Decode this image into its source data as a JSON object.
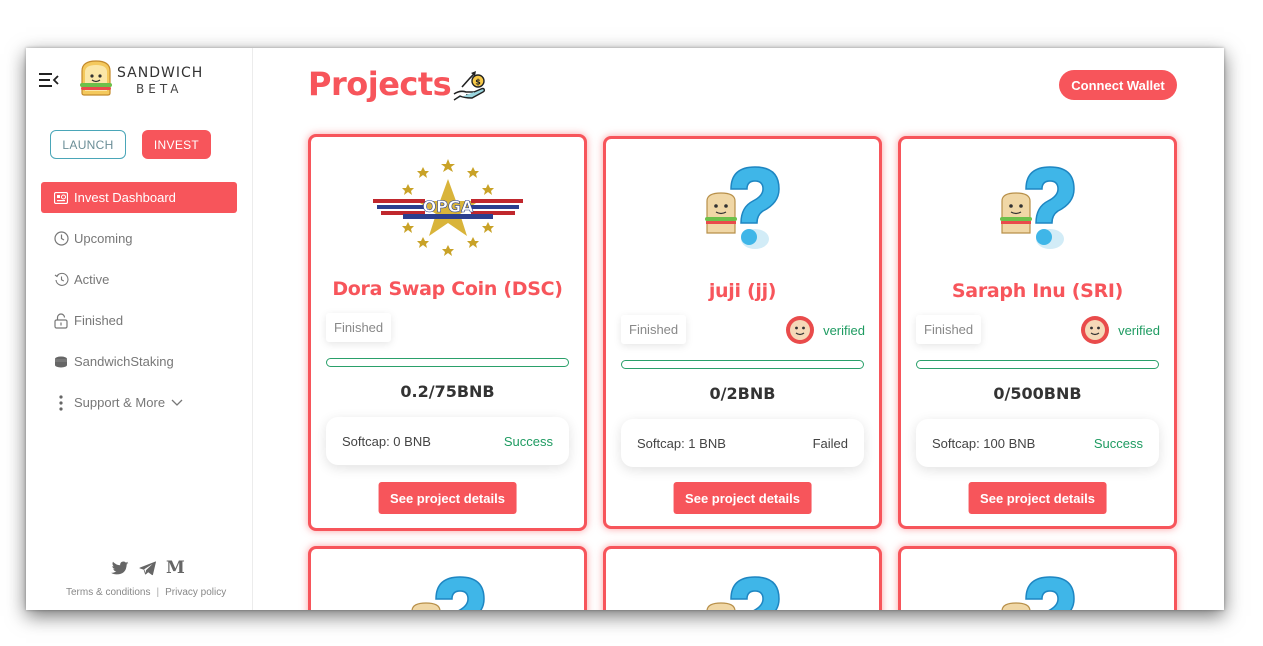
{
  "brand": {
    "name": "SANDWICH",
    "sub": "BETA"
  },
  "modes": {
    "launch": "LAUNCH",
    "invest": "INVEST"
  },
  "nav": [
    {
      "label": "Invest Dashboard",
      "icon": "dashboard-icon"
    },
    {
      "label": "Upcoming",
      "icon": "clock-icon"
    },
    {
      "label": "Active",
      "icon": "history-icon"
    },
    {
      "label": "Finished",
      "icon": "lock-icon"
    },
    {
      "label": "SandwichStaking",
      "icon": "coins-icon"
    },
    {
      "label": "Support & More",
      "icon": "more-vertical-icon"
    }
  ],
  "footer": {
    "terms": "Terms & conditions",
    "separator": "|",
    "privacy": "Privacy policy",
    "social_twitter": "twitter-icon",
    "social_telegram": "telegram-icon",
    "social_medium": "M"
  },
  "header": {
    "title": "Projects",
    "connect": "Connect Wallet"
  },
  "projects": [
    {
      "name": "Dora Swap Coin (DSC)",
      "status": "Finished",
      "verified": "",
      "raised": "0.2/75BNB",
      "softcap": "Softcap: 0 BNB",
      "result": "Success",
      "details": "See project details",
      "logo_text": "OPGA"
    },
    {
      "name": "juji (jj)",
      "status": "Finished",
      "verified": "verified",
      "raised": "0/2BNB",
      "softcap": "Softcap: 1 BNB",
      "result": "Failed",
      "details": "See project details"
    },
    {
      "name": "Saraph Inu (SRI)",
      "status": "Finished",
      "verified": "verified",
      "raised": "0/500BNB",
      "softcap": "Softcap: 100 BNB",
      "result": "Success",
      "details": "See project details"
    }
  ],
  "colors": {
    "accent": "#f7555b",
    "success": "#1e9b61",
    "launch_border": "#4aa6b8"
  }
}
